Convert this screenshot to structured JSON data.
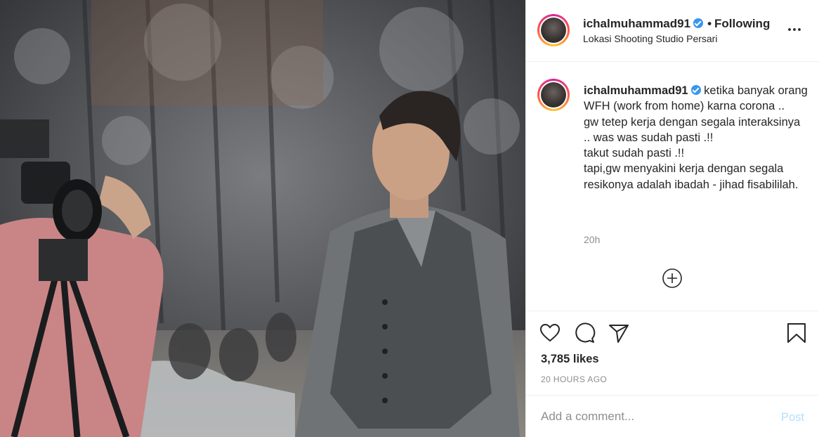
{
  "media": {
    "icon": "post-photo"
  },
  "header": {
    "username": "ichalmuhammad91",
    "verified_icon": "verified-badge-icon",
    "separator": "•",
    "follow_status": "Following",
    "location": "Lokasi Shooting Studio Persari",
    "more_icon": "more-options-icon"
  },
  "caption": {
    "username": "ichalmuhammad91",
    "text": "ketika banyak orang WFH (work from home) karna corona ..\ngw tetep kerja dengan segala interaksinya .. was was sudah pasti .!!\ntakut sudah pasti .!!\ntapi,gw menyakini kerja dengan segala resikonya adalah ibadah - jihad fisabililah.",
    "time": "20h",
    "load_more_icon": "plus-circle-icon"
  },
  "actions": {
    "like_icon": "heart-icon",
    "comment_icon": "comment-icon",
    "share_icon": "paper-plane-icon",
    "save_icon": "bookmark-icon",
    "likes": "3,785 likes",
    "posted": "20 HOURS AGO"
  },
  "comment": {
    "placeholder": "Add a comment...",
    "value": "",
    "post_label": "Post"
  },
  "colors": {
    "verified": "#3897f0",
    "post_disabled": "#b2dffc",
    "muted_text": "#8e8e8e",
    "text": "#262626"
  }
}
